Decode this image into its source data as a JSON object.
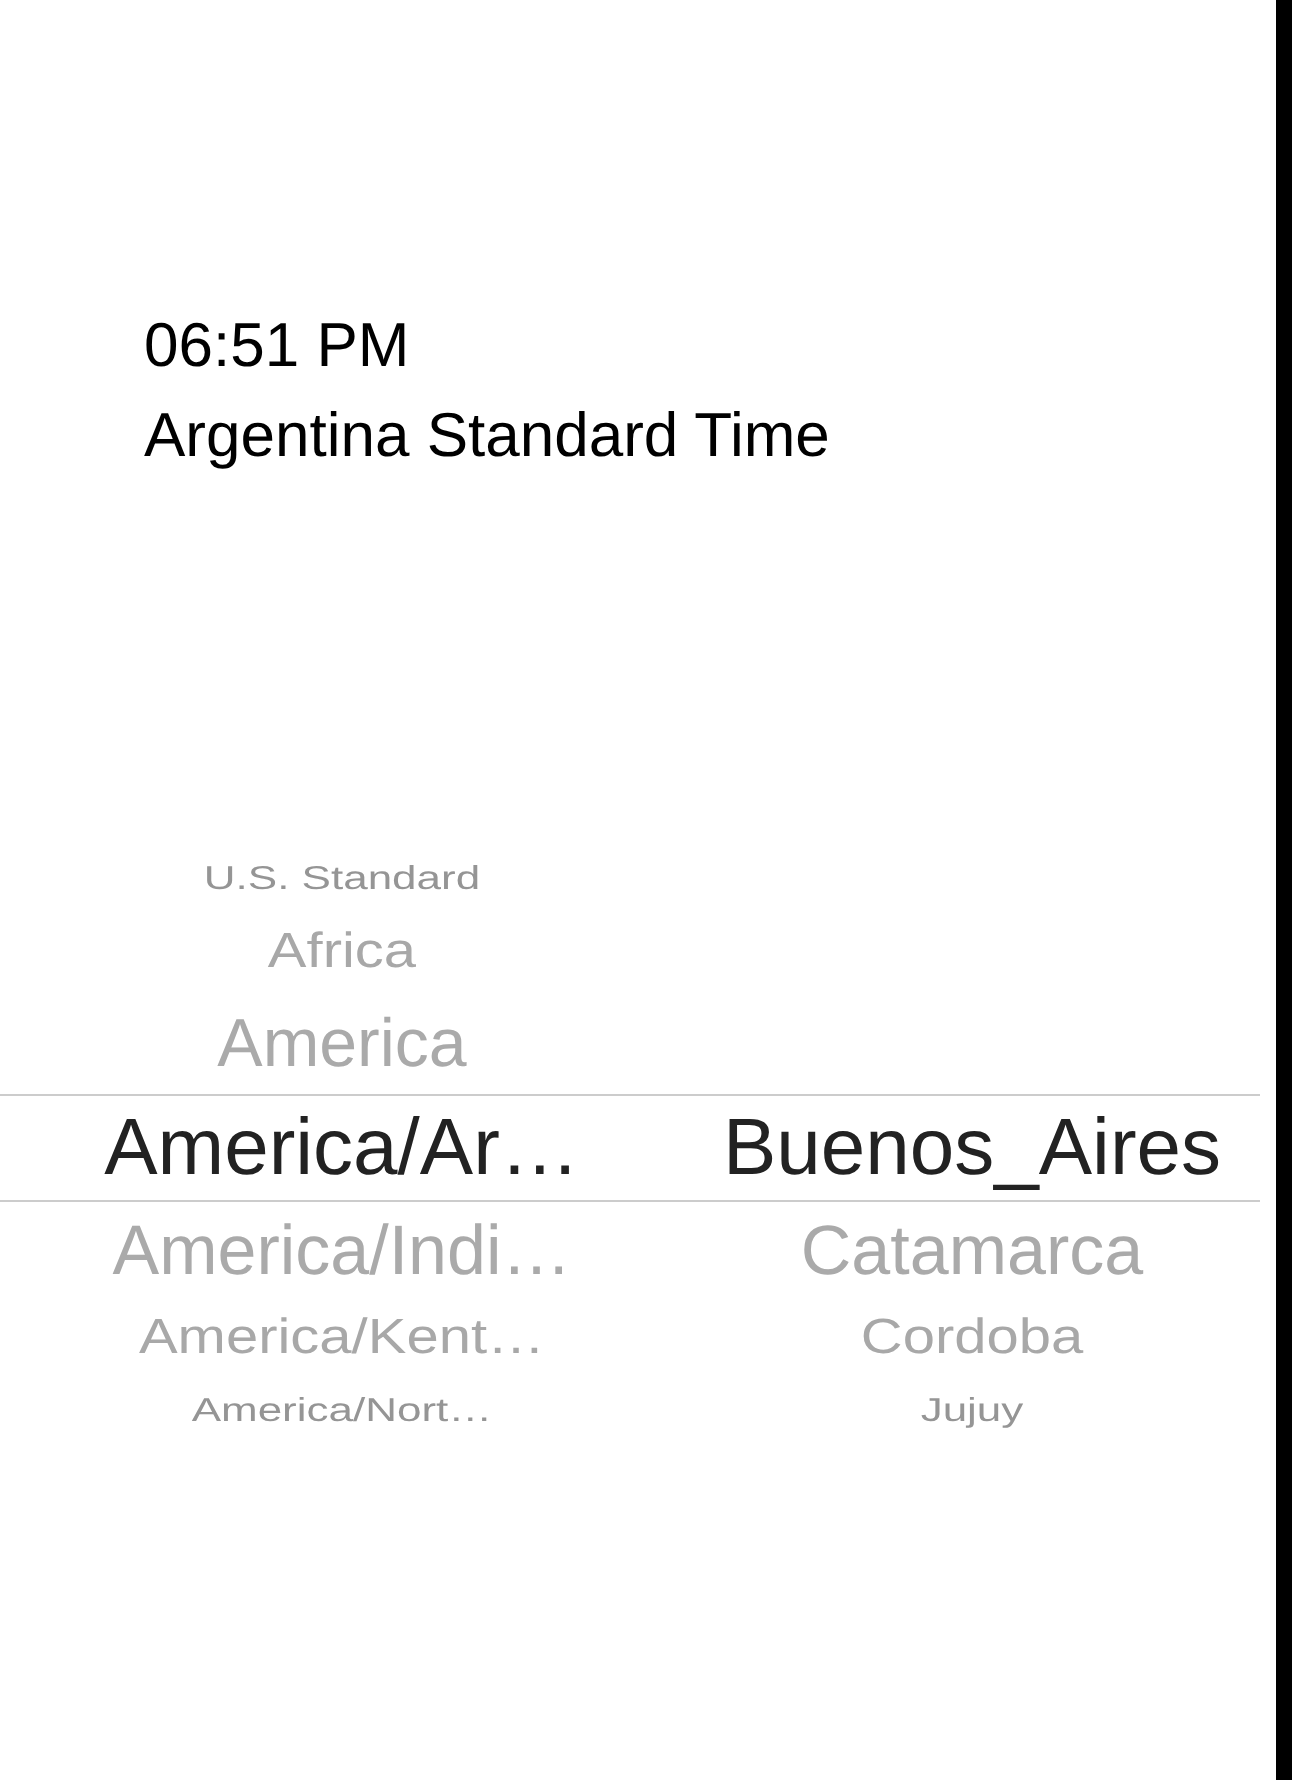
{
  "time": "06:51 PM",
  "timezone_name": "Argentina Standard Time",
  "picker": {
    "columns": [
      {
        "items": [
          {
            "label": "U.S. Standard",
            "selected": false
          },
          {
            "label": "Africa",
            "selected": false
          },
          {
            "label": "America",
            "selected": false
          },
          {
            "label": "America/Ar…",
            "selected": true
          },
          {
            "label": "America/Indi…",
            "selected": false
          },
          {
            "label": "America/Kent…",
            "selected": false
          },
          {
            "label": "America/Nort…",
            "selected": false
          }
        ]
      },
      {
        "items": [
          {
            "label": "Buenos_Aires",
            "selected": true
          },
          {
            "label": "Catamarca",
            "selected": false
          },
          {
            "label": "Cordoba",
            "selected": false
          },
          {
            "label": "Jujuy",
            "selected": false
          }
        ]
      }
    ]
  }
}
